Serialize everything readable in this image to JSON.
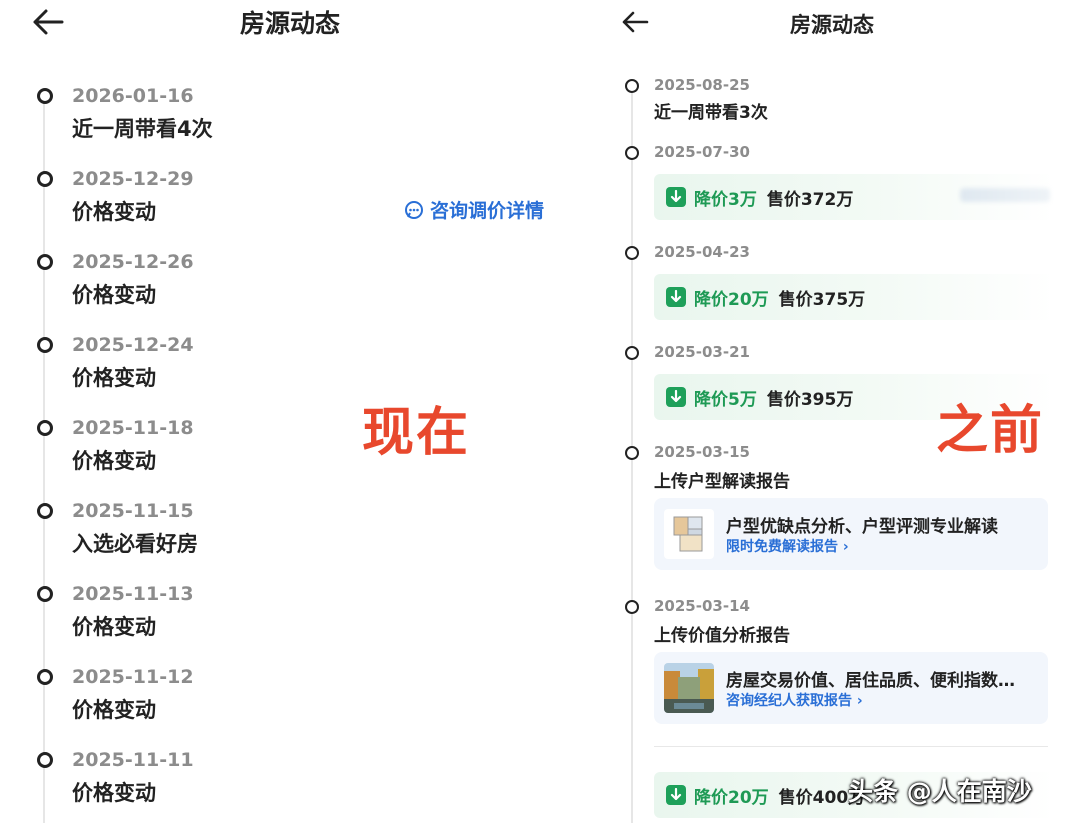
{
  "left": {
    "header": {
      "back_icon": "arrow-left-icon",
      "title": "房源动态"
    },
    "events": [
      {
        "date": "2026-01-16",
        "text": "近一周带看4次"
      },
      {
        "date": "2025-12-29",
        "text": "价格变动"
      },
      {
        "date": "2025-12-26",
        "text": "价格变动"
      },
      {
        "date": "2025-12-24",
        "text": "价格变动"
      },
      {
        "date": "2025-11-18",
        "text": "价格变动"
      },
      {
        "date": "2025-11-15",
        "text": "入选必看好房"
      },
      {
        "date": "2025-11-13",
        "text": "价格变动"
      },
      {
        "date": "2025-11-12",
        "text": "价格变动"
      },
      {
        "date": "2025-11-11",
        "text": "价格变动"
      }
    ],
    "consult_link": "咨询调价详情",
    "consult_icon": "chat-bubble-icon",
    "overlay_label": "现在"
  },
  "right": {
    "header": {
      "back_icon": "arrow-left-icon",
      "title": "房源动态"
    },
    "events": [
      {
        "date": "2025-08-25",
        "text": "近一周带看3次"
      },
      {
        "date": "2025-07-30",
        "drop": "降价3万",
        "price": "售价372万"
      },
      {
        "date": "2025-04-23",
        "drop": "降价20万",
        "price": "售价375万"
      },
      {
        "date": "2025-03-21",
        "drop": "降价5万",
        "price": "售价395万"
      },
      {
        "date": "2025-03-15",
        "text": "上传户型解读报告",
        "card": {
          "title": "户型优缺点分析、户型评测专业解读",
          "link": "限时免费解读报告 ›"
        }
      },
      {
        "date": "2025-03-14",
        "text": "上传价值分析报告",
        "card": {
          "title": "房屋交易价值、居住品质、便利指数…",
          "link": "咨询经纪人获取报告 ›"
        }
      }
    ],
    "last_price": {
      "drop": "降价20万",
      "price": "售价400万"
    },
    "overlay_label": "之前",
    "price_drop_icon": "arrow-down-icon"
  },
  "watermark": "头条 @人在南沙",
  "colors": {
    "accent_green": "#1e9a55",
    "link_blue": "#2a6fd6",
    "stamp_red": "#e8482d"
  }
}
